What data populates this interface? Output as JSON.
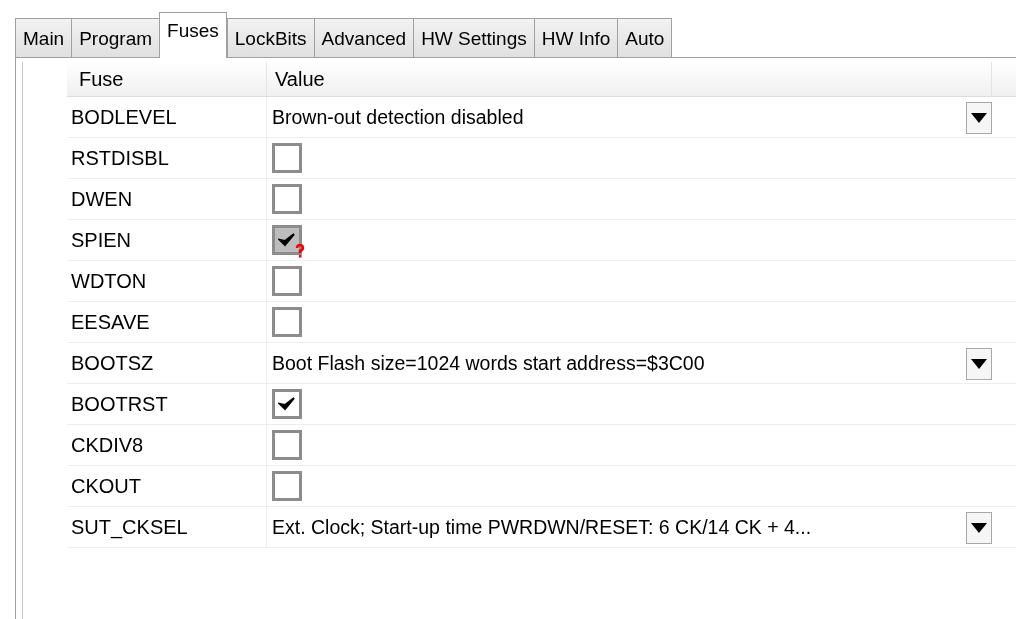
{
  "tabs": [
    {
      "label": "Main",
      "selected": false
    },
    {
      "label": "Program",
      "selected": false
    },
    {
      "label": "Fuses",
      "selected": true
    },
    {
      "label": "LockBits",
      "selected": false
    },
    {
      "label": "Advanced",
      "selected": false
    },
    {
      "label": "HW Settings",
      "selected": false
    },
    {
      "label": "HW Info",
      "selected": false
    },
    {
      "label": "Auto",
      "selected": false
    }
  ],
  "table": {
    "columns": [
      "Fuse",
      "Value"
    ],
    "rows": [
      {
        "fuse": "BODLEVEL",
        "kind": "select",
        "value": "Brown-out detection disabled"
      },
      {
        "fuse": "RSTDISBL",
        "kind": "checkbox",
        "checked": false,
        "uncertain": false
      },
      {
        "fuse": "DWEN",
        "kind": "checkbox",
        "checked": false,
        "uncertain": false
      },
      {
        "fuse": "SPIEN",
        "kind": "checkbox",
        "checked": true,
        "uncertain": true
      },
      {
        "fuse": "WDTON",
        "kind": "checkbox",
        "checked": false,
        "uncertain": false
      },
      {
        "fuse": "EESAVE",
        "kind": "checkbox",
        "checked": false,
        "uncertain": false
      },
      {
        "fuse": "BOOTSZ",
        "kind": "select",
        "value": "Boot Flash size=1024 words start address=$3C00"
      },
      {
        "fuse": "BOOTRST",
        "kind": "checkbox",
        "checked": true,
        "uncertain": false
      },
      {
        "fuse": "CKDIV8",
        "kind": "checkbox",
        "checked": false,
        "uncertain": false
      },
      {
        "fuse": "CKOUT",
        "kind": "checkbox",
        "checked": false,
        "uncertain": false
      },
      {
        "fuse": "SUT_CKSEL",
        "kind": "select",
        "value": "Ext. Clock; Start-up time PWRDWN/RESET: 6 CK/14 CK + 4..."
      }
    ]
  }
}
